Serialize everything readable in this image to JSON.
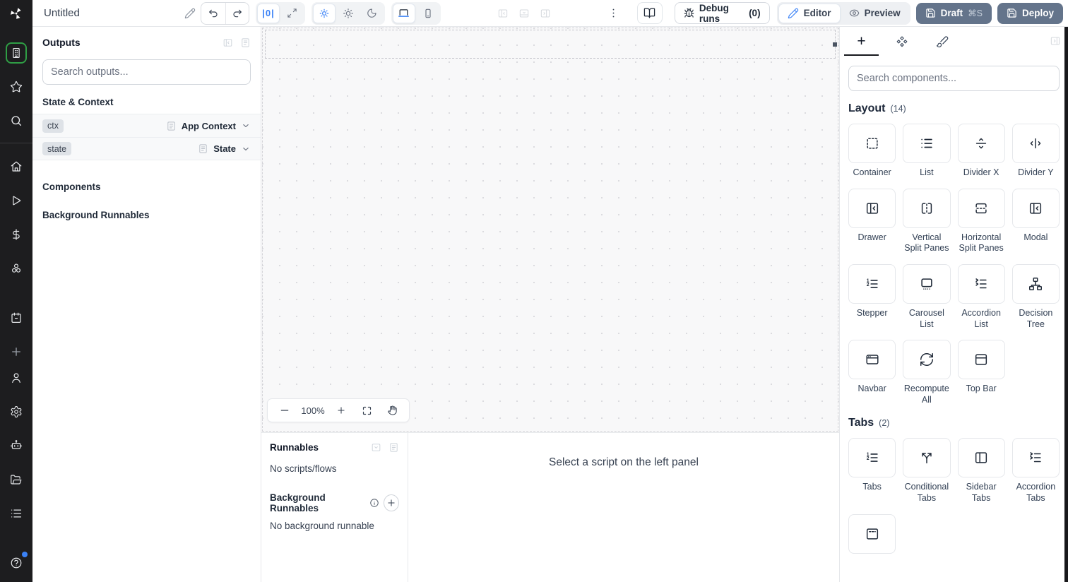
{
  "topbar": {
    "app_title": "Untitled",
    "width_toggle_label": "|0|",
    "debug_runs_label": "Debug runs",
    "debug_runs_count": "(0)",
    "editor_label": "Editor",
    "preview_label": "Preview",
    "draft_label": "Draft",
    "draft_shortcut": "⌘S",
    "deploy_label": "Deploy"
  },
  "sidebar": {
    "top_items": [
      {
        "name": "apps",
        "icon": "building",
        "active": true
      },
      {
        "name": "favorites",
        "icon": "star"
      },
      {
        "name": "search",
        "icon": "search"
      },
      {
        "divider": true
      },
      {
        "name": "home",
        "icon": "home"
      },
      {
        "name": "runs",
        "icon": "play"
      },
      {
        "name": "variables",
        "icon": "dollar"
      },
      {
        "name": "resources",
        "icon": "circles"
      },
      {
        "name": "schedules",
        "icon": "calendar",
        "gap": true
      },
      {
        "name": "create",
        "icon": "plus",
        "dim": true
      }
    ],
    "bottom_items": [
      {
        "name": "user",
        "icon": "user"
      },
      {
        "name": "settings",
        "icon": "gear"
      },
      {
        "name": "workers",
        "icon": "bot"
      },
      {
        "name": "folders",
        "icon": "folder-open"
      },
      {
        "name": "logs",
        "icon": "list"
      },
      {
        "name": "help",
        "icon": "help",
        "badge": true,
        "gap": true
      }
    ]
  },
  "outputs_panel": {
    "title": "Outputs",
    "search_placeholder": "Search outputs...",
    "state_context_title": "State & Context",
    "rows": [
      {
        "badge": "ctx",
        "type": "App Context"
      },
      {
        "badge": "state",
        "type": "State"
      }
    ],
    "components_title": "Components",
    "background_title": "Background Runnables"
  },
  "canvas": {
    "zoom_level": "100%"
  },
  "runnables_panel": {
    "title": "Runnables",
    "empty_scripts": "No scripts/flows",
    "background_title": "Background Runnables",
    "empty_background": "No background runnable"
  },
  "script_pane": {
    "message": "Select a script on the left panel"
  },
  "right_panel": {
    "search_placeholder": "Search components...",
    "sections": [
      {
        "title": "Layout",
        "count": "(14)",
        "items": [
          {
            "label": "Container",
            "icon": "container"
          },
          {
            "label": "List",
            "icon": "list-comp"
          },
          {
            "label": "Divider X",
            "icon": "divider-x"
          },
          {
            "label": "Divider Y",
            "icon": "divider-y"
          },
          {
            "label": "Drawer",
            "icon": "drawer"
          },
          {
            "label": "Vertical Split Panes",
            "icon": "vsplit"
          },
          {
            "label": "Horizontal Split Panes",
            "icon": "hsplit"
          },
          {
            "label": "Modal",
            "icon": "drawer"
          },
          {
            "label": "Stepper",
            "icon": "numbered-list"
          },
          {
            "label": "Carousel List",
            "icon": "carousel"
          },
          {
            "label": "Accordion List",
            "icon": "accordion"
          },
          {
            "label": "Decision Tree",
            "icon": "tree"
          },
          {
            "label": "Navbar",
            "icon": "navbar"
          },
          {
            "label": "Recompute All",
            "icon": "refresh"
          },
          {
            "label": "Top Bar",
            "icon": "top-bar"
          }
        ]
      },
      {
        "title": "Tabs",
        "count": "(2)",
        "items": [
          {
            "label": "Tabs",
            "icon": "numbered-list"
          },
          {
            "label": "Conditional Tabs",
            "icon": "split"
          },
          {
            "label": "Sidebar Tabs",
            "icon": "sidebar-tabs"
          },
          {
            "label": "Accordion Tabs",
            "icon": "accordion"
          },
          {
            "label": "",
            "icon": "modal-dashed"
          }
        ]
      }
    ]
  },
  "colors": {
    "accent_blue": "#3b82f6",
    "active_green": "#2f9e45",
    "button_slate": "#64748b",
    "rail_dark": "#1d1d1f"
  }
}
